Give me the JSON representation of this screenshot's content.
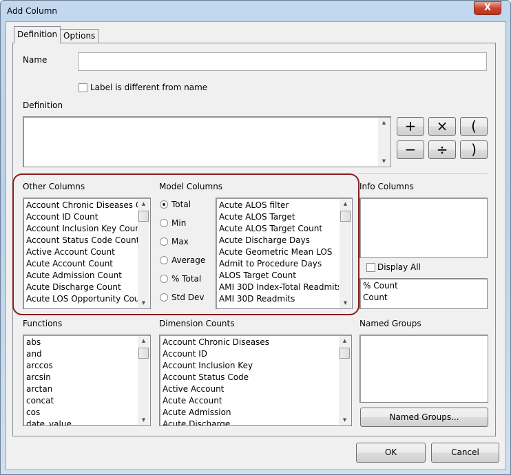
{
  "window": {
    "title": "Add Column",
    "close_label": "X"
  },
  "tabs": [
    {
      "label": "Definition"
    },
    {
      "label": "Options"
    }
  ],
  "name_label": "Name",
  "name_value": "",
  "label_checkbox": "Label is different from name",
  "definition_label": "Definition",
  "definition_value": "",
  "operators": [
    "+",
    "×",
    "(",
    "−",
    "÷",
    ")"
  ],
  "other_columns": {
    "label": "Other Columns",
    "items": [
      "Account Chronic Diseases C",
      "Account ID Count",
      "Account Inclusion Key Count",
      "Account Status Code Count",
      "Active Account Count",
      "Acute Account Count",
      "Acute Admission Count",
      "Acute Discharge Count",
      "Acute LOS Opportunity Cou"
    ]
  },
  "model_columns": {
    "label": "Model Columns",
    "items": [
      "Acute ALOS filter",
      "Acute ALOS Target",
      "Acute ALOS Target Count",
      "Acute Discharge Days",
      "Acute Geometric Mean LOS",
      "Admit to Procedure Days",
      "ALOS Target Count",
      "AMI 30D Index-Total Readmits",
      "AMI 30D Readmits"
    ]
  },
  "aggregations": [
    {
      "label": "Total",
      "selected": true
    },
    {
      "label": "Min"
    },
    {
      "label": "Max"
    },
    {
      "label": "Average"
    },
    {
      "label": "% Total"
    },
    {
      "label": "Std Dev"
    }
  ],
  "info_columns": {
    "label": "Info Columns",
    "display_all": "Display All",
    "counts": [
      "% Count",
      "Count"
    ]
  },
  "functions": {
    "label": "Functions",
    "items": [
      "abs",
      "and",
      "arccos",
      "arcsin",
      "arctan",
      "concat",
      "cos",
      "date_value"
    ]
  },
  "dimension_counts": {
    "label": "Dimension Counts",
    "items": [
      "Account Chronic Diseases",
      "Account ID",
      "Account Inclusion Key",
      "Account Status Code",
      "Active Account",
      "Acute Account",
      "Acute Admission",
      "Acute Discharge"
    ]
  },
  "named_groups": {
    "label": "Named Groups",
    "button": "Named Groups..."
  },
  "footer": {
    "ok": "OK",
    "cancel": "Cancel"
  }
}
